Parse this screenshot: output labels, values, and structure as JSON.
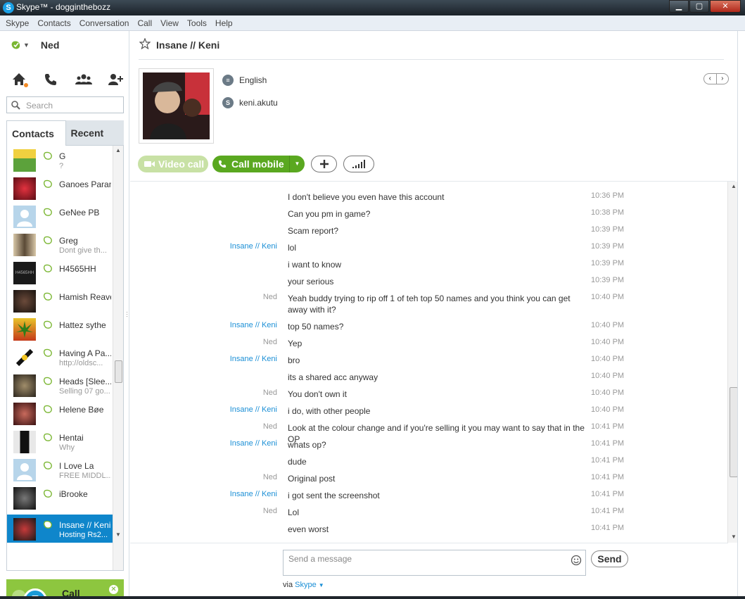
{
  "window": {
    "title": "Skype™ - dogginthebozz",
    "app_icon_letter": "S",
    "minimize": "▁",
    "maximize": "▢",
    "close": "✕"
  },
  "menu": [
    "Skype",
    "Contacts",
    "Conversation",
    "Call",
    "View",
    "Tools",
    "Help"
  ],
  "user": {
    "name": "Ned",
    "status_color": "#7ab632"
  },
  "search": {
    "placeholder": "Search"
  },
  "tabs": {
    "contacts": "Contacts",
    "recent": "Recent"
  },
  "contacts": [
    {
      "name": "G",
      "mood": "?",
      "avatar": "#5ca23b"
    },
    {
      "name": "Ganoes Paran",
      "mood": "",
      "avatar": "#b3172a"
    },
    {
      "name": "GeNee PB",
      "mood": "",
      "avatar": "#b7d5ea"
    },
    {
      "name": "Greg",
      "mood": "Dont give th...",
      "avatar": "#7b6a55"
    },
    {
      "name": "H4565HH",
      "mood": "",
      "avatar": "#222222"
    },
    {
      "name": "Hamish Reave",
      "mood": "",
      "avatar": "#3a2e26"
    },
    {
      "name": "Hattez sythe",
      "mood": "",
      "avatar": "#4c9a2a"
    },
    {
      "name": "Having A Pa...",
      "mood": "http://oldsc...",
      "avatar": "#1c1c1c"
    },
    {
      "name": "Heads [Slee...",
      "mood": "Selling 07 go...",
      "avatar": "#4a4238"
    },
    {
      "name": "Helene Bøe",
      "mood": "",
      "avatar": "#6e2a2a"
    },
    {
      "name": "Hentai",
      "mood": "Why",
      "avatar": "#2b2b2b"
    },
    {
      "name": "I Love La",
      "mood": "FREE MIDDL...",
      "avatar": "#b7d5ea"
    },
    {
      "name": "iBrooke",
      "mood": "",
      "avatar": "#3b3b3b"
    },
    {
      "name": "Insane // Keni",
      "mood": "Hosting Rs2...",
      "avatar": "#2a2a2a"
    }
  ],
  "promo": {
    "text": "Call landlines..."
  },
  "conversation": {
    "title": "Insane // Keni",
    "language": "English",
    "skype_name": "keni.akutu",
    "pager_prev": "‹",
    "pager_next": "›",
    "video_call": "Video call",
    "call_mobile": "Call mobile"
  },
  "messages": [
    {
      "sender": "",
      "type": "",
      "text": "I don't believe you even have this account",
      "time": "10:36 PM"
    },
    {
      "sender": "",
      "type": "",
      "text": "Can you pm in game?",
      "time": "10:38 PM"
    },
    {
      "sender": "",
      "type": "",
      "text": "Scam report?",
      "time": "10:39 PM"
    },
    {
      "sender": "Insane // Keni",
      "type": "keni",
      "text": "lol",
      "time": "10:39 PM"
    },
    {
      "sender": "",
      "type": "",
      "text": "i want to know",
      "time": "10:39 PM"
    },
    {
      "sender": "",
      "type": "",
      "text": "your serious",
      "time": "10:39 PM"
    },
    {
      "sender": "Ned",
      "type": "ned",
      "text": "Yeah buddy trying to rip off 1 of teh top 50 names and you think you can get away with it?",
      "time": "10:40 PM"
    },
    {
      "sender": "Insane // Keni",
      "type": "keni",
      "text": "top 50 names?",
      "time": "10:40 PM"
    },
    {
      "sender": "Ned",
      "type": "ned",
      "text": "Yep",
      "time": "10:40 PM"
    },
    {
      "sender": "Insane // Keni",
      "type": "keni",
      "text": "bro",
      "time": "10:40 PM"
    },
    {
      "sender": "",
      "type": "",
      "text": "its a shared acc anyway",
      "time": "10:40 PM"
    },
    {
      "sender": "Ned",
      "type": "ned",
      "text": "You don't own it",
      "time": "10:40 PM"
    },
    {
      "sender": "Insane // Keni",
      "type": "keni",
      "text": "i do, with other people",
      "time": "10:40 PM"
    },
    {
      "sender": "Ned",
      "type": "ned",
      "text": "Look at the colour change and if you're selling it you may want to say that in the OP",
      "time": "10:41 PM"
    },
    {
      "sender": "Insane // Keni",
      "type": "keni",
      "text": "whats op?",
      "time": "10:41 PM"
    },
    {
      "sender": "",
      "type": "",
      "text": "dude",
      "time": "10:41 PM"
    },
    {
      "sender": "Ned",
      "type": "ned",
      "text": "Original post",
      "time": "10:41 PM"
    },
    {
      "sender": "Insane // Keni",
      "type": "keni",
      "text": "i got sent the screenshot",
      "time": "10:41 PM"
    },
    {
      "sender": "Ned",
      "type": "ned",
      "text": "Lol",
      "time": "10:41 PM"
    },
    {
      "sender": "",
      "type": "",
      "text": "even worst",
      "time": "10:41 PM"
    }
  ],
  "compose": {
    "placeholder": "Send a message",
    "send": "Send",
    "via": "via",
    "via_service": "Skype"
  }
}
